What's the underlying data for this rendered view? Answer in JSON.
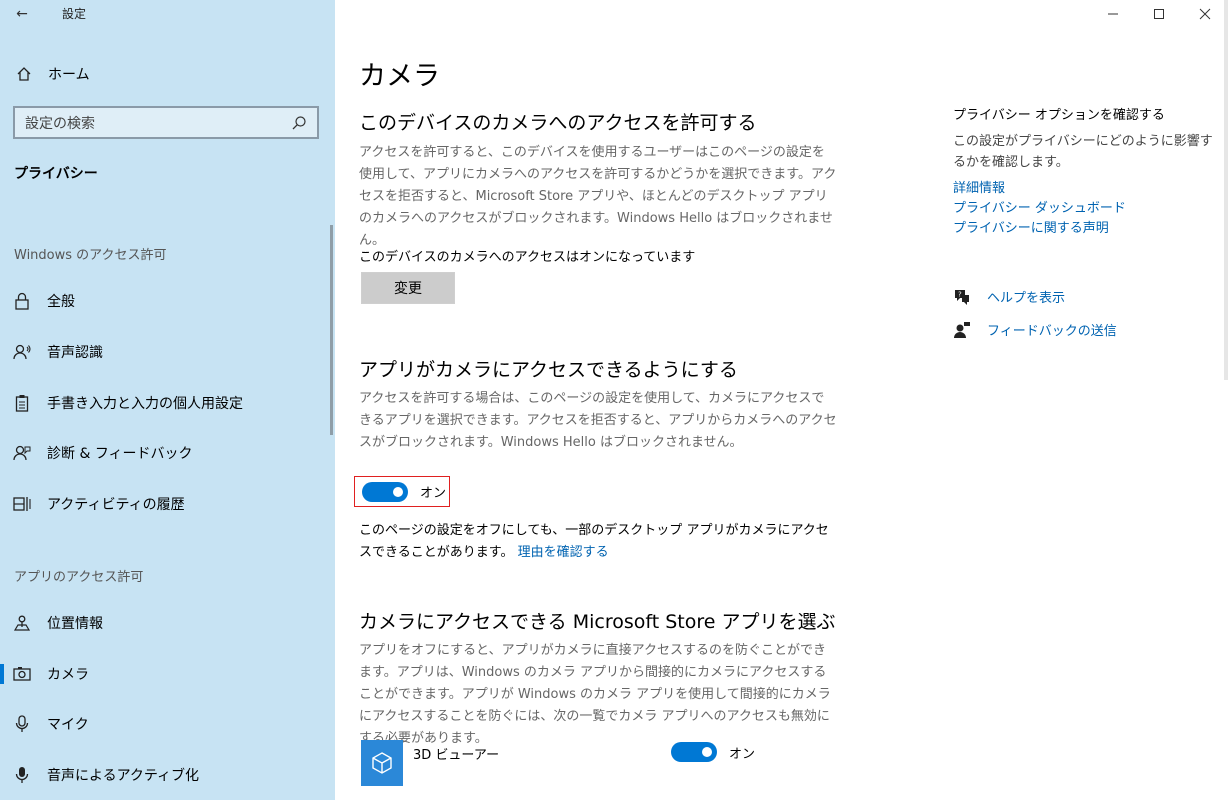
{
  "window": {
    "title": "設定",
    "back_glyph": "←",
    "controls": [
      "minimize",
      "maximize",
      "close"
    ]
  },
  "sidebar": {
    "home_label": "ホーム",
    "search_placeholder": "設定の検索",
    "section_label": "プライバシー",
    "groups": [
      {
        "title": "Windows のアクセス許可",
        "items": [
          {
            "label": "全般",
            "icon": "lock-icon"
          },
          {
            "label": "音声認識",
            "icon": "speech-icon"
          },
          {
            "label": "手書き入力と入力の個人用設定",
            "icon": "clipboard-icon"
          },
          {
            "label": "診断 & フィードバック",
            "icon": "person-feedback-icon"
          },
          {
            "label": "アクティビティの履歴",
            "icon": "timeline-icon"
          }
        ]
      },
      {
        "title": "アプリのアクセス許可",
        "items": [
          {
            "label": "位置情報",
            "icon": "location-icon"
          },
          {
            "label": "カメラ",
            "icon": "camera-icon",
            "active": true
          },
          {
            "label": "マイク",
            "icon": "microphone-icon"
          },
          {
            "label": "音声によるアクティブ化",
            "icon": "voice-activation-icon"
          }
        ]
      }
    ]
  },
  "main": {
    "page_title": "カメラ",
    "device_section": {
      "heading": "このデバイスのカメラへのアクセスを許可する",
      "description": "アクセスを許可すると、このデバイスを使用するユーザーはこのページの設定を使用して、アプリにカメラへのアクセスを許可するかどうかを選択できます。アクセスを拒否すると、Microsoft Store アプリや、ほとんどのデスクトップ アプリのカメラへのアクセスがブロックされます。Windows Hello はブロックされません。",
      "status": "このデバイスのカメラへのアクセスはオンになっています",
      "change_button": "変更"
    },
    "apps_section": {
      "heading": "アプリがカメラにアクセスできるようにする",
      "description": "アクセスを許可する場合は、このページの設定を使用して、カメラにアクセスできるアプリを選択できます。アクセスを拒否すると、アプリからカメラへのアクセスがブロックされます。Windows Hello はブロックされません。",
      "toggle_state": "オン",
      "toggle_on": true,
      "note": "このページの設定をオフにしても、一部のデスクトップ アプリがカメラにアクセスできることがあります。",
      "note_link": "理由を確認する"
    },
    "store_section": {
      "heading": "カメラにアクセスできる Microsoft Store アプリを選ぶ",
      "description": "アプリをオフにすると、アプリがカメラに直接アクセスするのを防ぐことができます。アプリは、Windows のカメラ アプリから間接的にカメラにアクセスすることができます。アプリが Windows のカメラ アプリを使用して間接的にカメラにアクセスすることを防ぐには、次の一覧でカメラ アプリへのアクセスも無効にする必要があります。",
      "apps": [
        {
          "name": "3D ビューアー",
          "state": "オン",
          "on": true
        }
      ]
    }
  },
  "side_panel": {
    "title": "プライバシー オプションを確認する",
    "description": "この設定がプライバシーにどのように影響するかを確認します。",
    "links": [
      "詳細情報",
      "プライバシー ダッシュボード",
      "プライバシーに関する声明"
    ],
    "help_label": "ヘルプを表示",
    "feedback_label": "フィードバックの送信"
  },
  "colors": {
    "sidebar_bg": "#c7e3f3",
    "accent": "#0078d4",
    "link": "#0063b1",
    "highlight_border": "#e02020"
  }
}
